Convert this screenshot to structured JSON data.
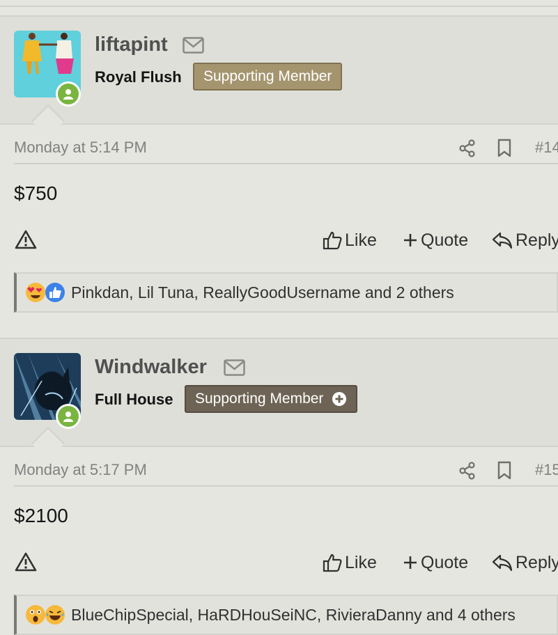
{
  "posts": [
    {
      "username": "liftapint",
      "user_title": "Royal Flush",
      "badge": "Supporting Member",
      "date": "Monday at 5:14 PM",
      "post_number": "#14",
      "content": "$750",
      "reactions_text": "Pinkdan, Lil Tuna, ReallyGoodUsername and 2 others",
      "reaction_icons": [
        "heart-eyes-icon",
        "like-icon"
      ]
    },
    {
      "username": "Windwalker",
      "user_title": "Full House",
      "badge": "Supporting Member",
      "date": "Monday at 5:17 PM",
      "post_number": "#15",
      "content": "$2100",
      "reactions_text": "BlueChipSpecial, HaRDHouSeiNC, RivieraDanny and 4 others",
      "reaction_icons": [
        "wow-icon",
        "laugh-icon"
      ]
    }
  ],
  "actions": {
    "like": "Like",
    "quote": "Quote",
    "reply": "Reply"
  },
  "colors": {
    "badge_light": "#a5956f",
    "badge_dark": "#6e6455",
    "online": "#7ab541",
    "header_bg": "#dedfd9"
  }
}
